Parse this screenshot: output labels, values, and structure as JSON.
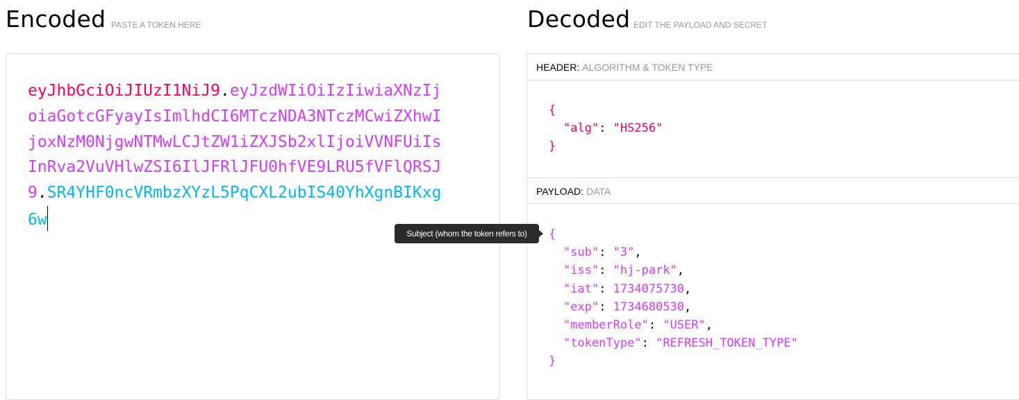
{
  "encoded": {
    "title": "Encoded",
    "subtitle": "PASTE A TOKEN HERE",
    "token": {
      "header": "eyJhbGciOiJIUzI1NiJ9",
      "payload": "eyJzdWIiOiIzIiwiaXNzIjoiaGotcGFyayIsImlhdCI6MTczNDA3NTczMCwiZXhwIjoxNzM0NjgwNTMwLCJtZW1iZXJSb2xlIjoiVVNFUiIsInRva2VuVHlwZSI6IlJFRlJFU0hfVE9LRU5fVFlQRSJ9",
      "signature": "SR4YHF0ncVRmbzXYzL5PqCXL2ubIS40YhXgnBIKxg6w",
      "dot": "."
    }
  },
  "tooltip": "Subject (whom the token refers to)",
  "decoded": {
    "title": "Decoded",
    "subtitle": "EDIT THE PAYLOAD AND SECRET",
    "header_section": {
      "label": "HEADER:",
      "desc": "ALGORITHM & TOKEN TYPE",
      "fields": [
        {
          "key": "\"alg\"",
          "value": "\"HS256\""
        }
      ]
    },
    "payload_section": {
      "label": "PAYLOAD:",
      "desc": "DATA",
      "fields": [
        {
          "key": "\"sub\"",
          "value": "\"3\""
        },
        {
          "key": "\"iss\"",
          "value": "\"hj-park\""
        },
        {
          "key": "\"iat\"",
          "value": "1734075730"
        },
        {
          "key": "\"exp\"",
          "value": "1734680530"
        },
        {
          "key": "\"memberRole\"",
          "value": "\"USER\""
        },
        {
          "key": "\"tokenType\"",
          "value": "\"REFRESH_TOKEN_TYPE\""
        }
      ]
    },
    "open_brace": "{",
    "close_brace": "}"
  },
  "colors": {
    "header": "#fb015b",
    "payload": "#d63aff",
    "signature": "#00b9f1"
  }
}
